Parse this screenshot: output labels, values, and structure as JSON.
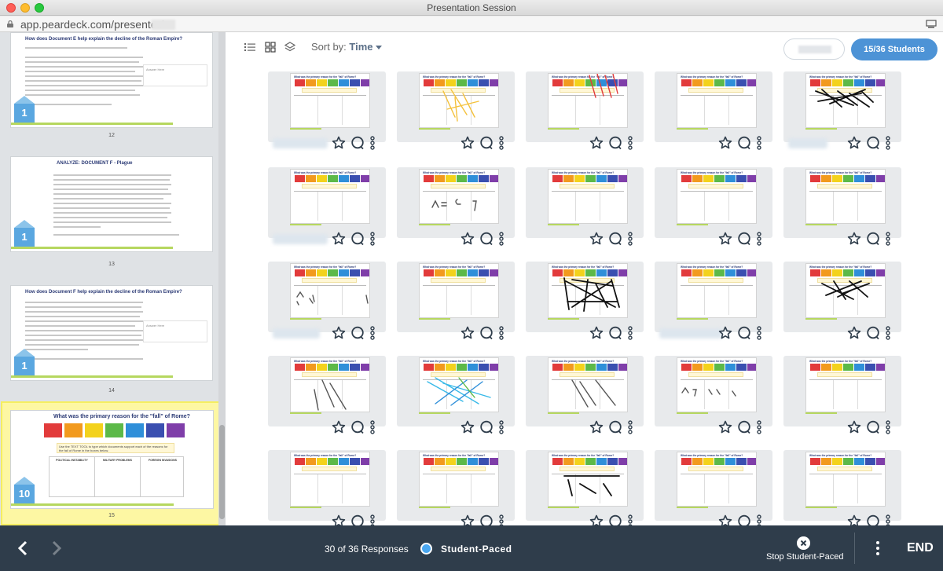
{
  "window": {
    "title": "Presentation Session",
    "url": "app.peardeck.com/presenter/"
  },
  "slides_panel": {
    "slides": [
      {
        "number": "12",
        "title": "How does Document E help explain the decline of the Roman Empire?",
        "responses": "1",
        "answer_label": "Answer Here"
      },
      {
        "number": "13",
        "title": "ANALYZE: DOCUMENT F - Plague",
        "responses": "1",
        "answer_label": ""
      },
      {
        "number": "14",
        "title": "How does Document F help explain the decline of the Roman Empire?",
        "responses": "1",
        "answer_label": "Answer Here"
      },
      {
        "number": "15",
        "title": "What was the primary reason for the \"fall\" of Rome?",
        "responses": "10",
        "answer_label": "",
        "selected": true,
        "note": "Use the TEXT TOOL to type which documents support each of the reasons for the fall of Rome in the boxes below.",
        "columns": [
          "POLITICAL INSTABILITY",
          "MILITARY PROBLEMS",
          "FOREIGN INVASIONS"
        ]
      }
    ]
  },
  "toolbar": {
    "sort_label": "Sort by:",
    "sort_value": "Time",
    "students_button": "15/36 Students"
  },
  "grid": {
    "card_title": "What was the primary reason for the \"fall\" of Rome?",
    "box_colors": [
      "#e23b3b",
      "#f29a1e",
      "#f3d21c",
      "#5cb948",
      "#2f8fd9",
      "#3a4fb0",
      "#7f3ea9"
    ],
    "ink_colors": {
      "red": "#e33b3b",
      "yellow": "#f4c13c",
      "black": "#111111",
      "blue": "#2f8fd9",
      "cyan": "#37b9e8",
      "green": "#5cb948",
      "gray": "#555555"
    }
  },
  "bottom_bar": {
    "responses": "30 of 36 Responses",
    "mode": "Student-Paced",
    "stop_label": "Stop Student-Paced",
    "end_label": "END"
  }
}
